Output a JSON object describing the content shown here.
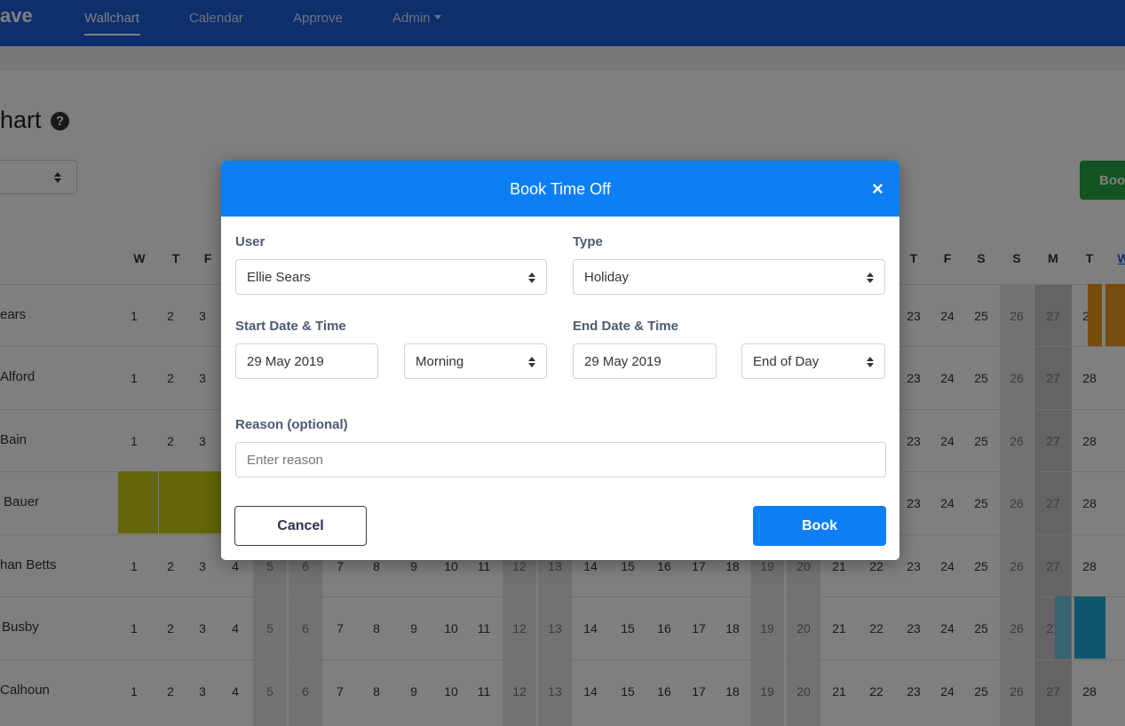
{
  "navbar": {
    "brand": "ave",
    "items": [
      {
        "label": "Wallchart"
      },
      {
        "label": "Calendar"
      },
      {
        "label": "Approve"
      },
      {
        "label": "Admin"
      }
    ]
  },
  "page": {
    "title": "hart",
    "help_icon": "?",
    "book_button": "Boo"
  },
  "wallchart": {
    "day_headers": [
      "W",
      "T",
      "F",
      "T",
      "F",
      "S",
      "S",
      "M",
      "T",
      "W"
    ],
    "rows": [
      {
        "name": "ears"
      },
      {
        "name": "Alford"
      },
      {
        "name": "Bain"
      },
      {
        "name": "Bauer"
      },
      {
        "name": "han Betts"
      },
      {
        "name": "Busby"
      },
      {
        "name": "Calhoun"
      }
    ],
    "left_days": [
      "1",
      "2",
      "3"
    ],
    "middle_days": [
      "4",
      "5",
      "6",
      "7",
      "8",
      "9",
      "10",
      "11",
      "12",
      "13",
      "14",
      "15",
      "16",
      "17",
      "18",
      "19",
      "20",
      "21",
      "22"
    ],
    "right_days": [
      "23",
      "24",
      "25",
      "26",
      "27",
      "28"
    ],
    "first_row_right_day": "23",
    "leave_colors": {
      "holiday_yellow": "#c4cd10",
      "orange": "#f0961c",
      "blue": "#1eaadc",
      "light_blue": "#6cc4e4"
    }
  },
  "modal": {
    "title": "Book Time Off",
    "close_icon": "×",
    "user_label": "User",
    "user_value": "Ellie Sears",
    "type_label": "Type",
    "type_value": "Holiday",
    "start_label": "Start Date & Time",
    "start_date": "29 May 2019",
    "start_time": "Morning",
    "end_label": "End Date & Time",
    "end_date": "29 May 2019",
    "end_time": "End of Day",
    "reason_label": "Reason (optional)",
    "reason_placeholder": "Enter reason",
    "cancel_label": "Cancel",
    "book_label": "Book"
  },
  "colors": {
    "navbar": "#1a5ed8",
    "modal_header": "#0d7ff6",
    "book_button": "#0d7ff6",
    "page_book_button": "#28a745"
  }
}
